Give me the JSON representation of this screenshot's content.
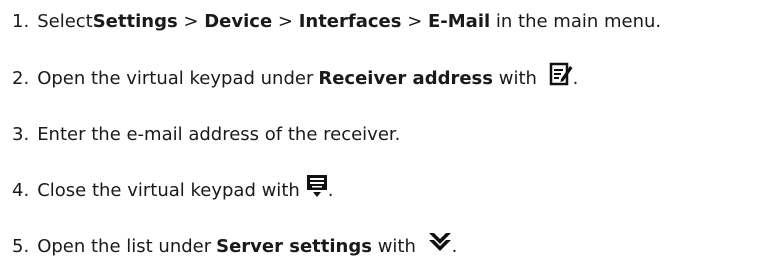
{
  "steps": [
    {
      "number": "1.",
      "parts": [
        "Select ",
        "Settings",
        " > ",
        "Device",
        " > ",
        "Interfaces",
        " > ",
        "E-Mail",
        " in the main menu."
      ]
    },
    {
      "number": "2.",
      "parts": [
        "Open the virtual keypad under ",
        "Receiver address",
        " with ",
        "."
      ],
      "icon": "edit-icon"
    },
    {
      "number": "3.",
      "parts": [
        "Enter the e-mail address of the receiver."
      ]
    },
    {
      "number": "4.",
      "parts": [
        "Close the virtual keypad with ",
        "."
      ],
      "icon": "keypad-close-icon"
    },
    {
      "number": "5.",
      "parts": [
        "Open the list under ",
        "Server settings",
        " with ",
        "."
      ],
      "icon": "chevron-double-down-icon"
    }
  ]
}
